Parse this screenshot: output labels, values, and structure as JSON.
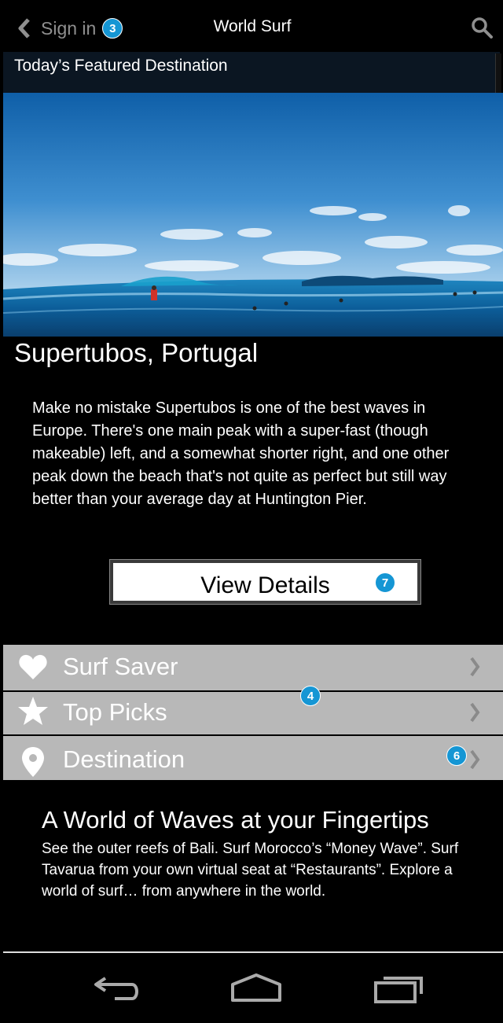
{
  "header": {
    "back_label": "Sign in",
    "back_badge": "3",
    "title": "World Surf"
  },
  "featured": {
    "label": "Today’s Featured Destination"
  },
  "destination": {
    "title": "Supertubos, Portugal",
    "description": "Make no mistake Supertubos is one of the best waves in Europe. There's one main peak with a super-fast (though makeable) left, and a somewhat shorter right, and one other peak down the beach that's not quite as perfect but still way better than your average day at Huntington Pier.",
    "details_button": "View Details",
    "details_badge": "7"
  },
  "menu": {
    "items": [
      {
        "label": "Surf Saver",
        "icon": "heart-icon"
      },
      {
        "label": "Top Picks",
        "icon": "star-icon"
      },
      {
        "label": "Destination",
        "icon": "map-pin-icon"
      }
    ],
    "group_badge": "4",
    "destination_badge": "6"
  },
  "promo": {
    "title": "A World of Waves at your Fingertips",
    "body": "See the outer reefs of Bali. Surf Morocco’s “Money Wave”. Surf Tavarua from your own virtual seat at “Restaurants”. Explore a world of surf… from anywhere in the world."
  },
  "colors": {
    "accent_badge": "#1596d4",
    "menu_bg": "#b8b8b8",
    "featured_bar": "#0b1622"
  }
}
